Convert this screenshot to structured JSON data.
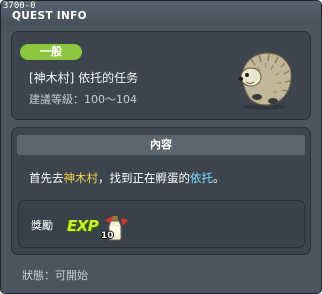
{
  "window": {
    "quest_id": "3700-0",
    "title": "QUEST INFO"
  },
  "quest": {
    "level_badge": "一般",
    "name": "[神木村] 依托的任务",
    "recommended_level": "建議等級：100～104"
  },
  "content": {
    "header": "內容",
    "description": {
      "part1": "首先去",
      "place": "神木村",
      "part2": "，找到正在孵蛋的",
      "target": "依托",
      "part3": "。"
    }
  },
  "reward": {
    "label": "獎勵",
    "exp_icon_text": "EXP",
    "item_count": "10"
  },
  "status": "狀態：可開始",
  "icons": [
    "hedgehog-npc-icon",
    "exp-icon",
    "potion-bottle-icon"
  ],
  "colors": {
    "window_bg": "#4a5560",
    "panel_bg": "#3c454d",
    "pill_green": "#8cc63f",
    "highlight_yellow": "#f6d24b",
    "highlight_cyan": "#7fe0ff",
    "exp_green": "#c8f02e"
  }
}
